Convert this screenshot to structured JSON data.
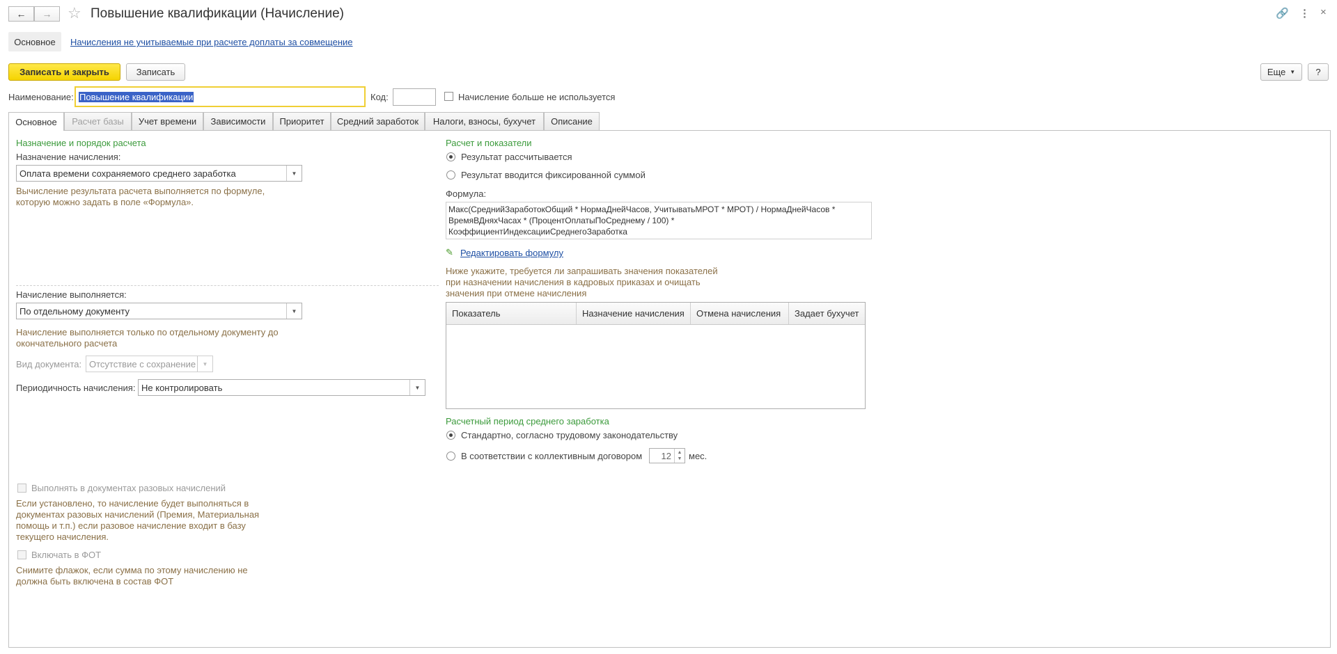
{
  "window": {
    "title": "Повышение квалификации (Начисление)",
    "back_icon": "arrow-left-icon",
    "forward_icon": "arrow-right-icon"
  },
  "top_tabs": {
    "main": "Основное",
    "link": "Начисления не учитываемые при расчете доплаты за совмещение"
  },
  "toolbar": {
    "save_close": "Записать и закрыть",
    "save": "Записать",
    "more": "Еще",
    "help": "?"
  },
  "header": {
    "name_label": "Наименование:",
    "name_value": "Повышение квалификации",
    "code_label": "Код:",
    "code_value": "",
    "unused_label": "Начисление больше не используется"
  },
  "tabs": [
    {
      "label": "Основное",
      "active": true
    },
    {
      "label": "Расчет базы",
      "disabled": true
    },
    {
      "label": "Учет времени"
    },
    {
      "label": "Зависимости"
    },
    {
      "label": "Приоритет"
    },
    {
      "label": "Средний заработок"
    },
    {
      "label": "Налоги, взносы, бухучет"
    },
    {
      "label": "Описание"
    }
  ],
  "left": {
    "section_title": "Назначение и порядок расчета",
    "purpose_label": "Назначение начисления:",
    "purpose_value": "Оплата времени сохраняемого среднего заработка",
    "purpose_hint_1": "Вычисление результата расчета выполняется по формуле,",
    "purpose_hint_2": "которую можно задать в поле «Формула».",
    "exec_label": "Начисление выполняется:",
    "exec_value": "По отдельному документу",
    "exec_hint_1": "Начисление выполняется только по отдельному документу до",
    "exec_hint_2": "окончательного расчета",
    "doc_type_label": "Вид документа:",
    "doc_type_value": "Отсутствие с сохранение",
    "period_label": "Периодичность начисления:",
    "period_value": "Не контролировать",
    "one_time_label": "Выполнять в документах разовых начислений",
    "one_time_hint_1": "Если установлено, то начисление будет выполняться в",
    "one_time_hint_2": "документах разовых начислений (Премия, Материальная",
    "one_time_hint_3": "помощь и т.п.) если разовое начисление входит в базу",
    "one_time_hint_4": "текущего начисления.",
    "fot_label": "Включать в ФОТ",
    "fot_hint_1": "Снимите флажок, если сумма по этому начислению не",
    "fot_hint_2": "должна быть включена в состав ФОТ"
  },
  "right": {
    "section_title": "Расчет и показатели",
    "radio_calc": "Результат рассчитывается",
    "radio_fixed": "Результат вводится фиксированной суммой",
    "formula_label": "Формула:",
    "formula_line_1": "Макс(СреднийЗаработокОбщий * НормаДнейЧасов, УчитыватьМРОТ * МРОТ) / НормаДнейЧасов *",
    "formula_line_2": "ВремяВДняхЧасах * (ПроцентОплатыПоСреднему / 100) *",
    "formula_line_3": "КоэффициентИндексацииСреднегоЗаработка",
    "edit_formula": "Редактировать формулу",
    "indicators_hint_1": "Ниже укажите, требуется ли запрашивать значения показателей",
    "indicators_hint_2": "при назначении начисления в кадровых приказах и очищать",
    "indicators_hint_3": "значения при отмене начисления",
    "grid_columns": [
      "Показатель",
      "Назначение начисления",
      "Отмена начисления",
      "Задает бухучет"
    ],
    "avg_period_title": "Расчетный период среднего заработка",
    "radio_standard": "Стандартно, согласно трудовому законодательству",
    "radio_collective": "В соответствии с коллективным договором",
    "months_value": "12",
    "months_unit": "мес."
  }
}
